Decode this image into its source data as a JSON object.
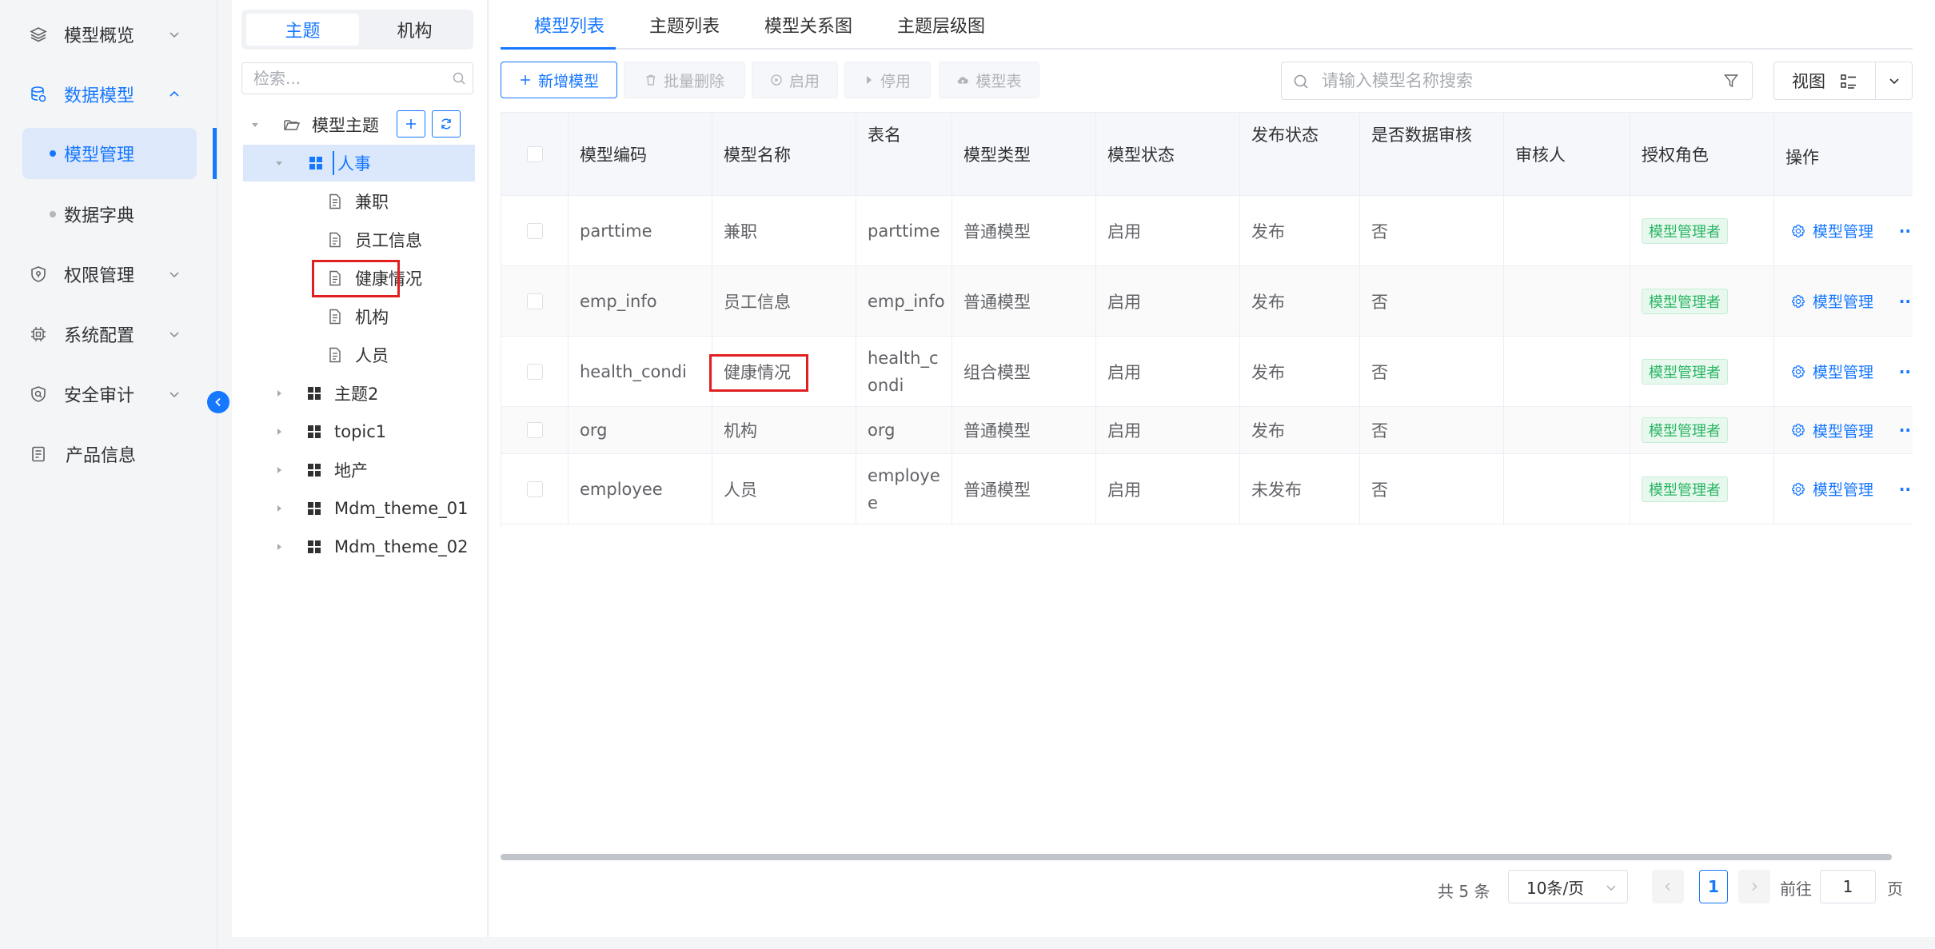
{
  "sidebar": {
    "items": [
      {
        "label": "模型概览",
        "icon": "layers-icon"
      },
      {
        "label": "数据模型",
        "icon": "database-icon"
      },
      {
        "label": "权限管理",
        "icon": "shield-icon"
      },
      {
        "label": "系统配置",
        "icon": "chip-icon"
      },
      {
        "label": "安全审计",
        "icon": "audit-shield-icon"
      },
      {
        "label": "产品信息",
        "icon": "document-icon"
      }
    ],
    "sub_items": [
      {
        "label": "模型管理"
      },
      {
        "label": "数据字典"
      }
    ]
  },
  "tree": {
    "segments": [
      "主题",
      "机构"
    ],
    "search_placeholder": "检索...",
    "root": "模型主题",
    "nodes": [
      {
        "label": "人事"
      },
      {
        "label": "兼职"
      },
      {
        "label": "员工信息"
      },
      {
        "label": "健康情况"
      },
      {
        "label": "机构"
      },
      {
        "label": "人员"
      },
      {
        "label": "主题2"
      },
      {
        "label": "topic1"
      },
      {
        "label": "地产"
      },
      {
        "label": "Mdm_theme_01"
      },
      {
        "label": "Mdm_theme_02"
      }
    ]
  },
  "tabs": [
    "模型列表",
    "主题列表",
    "模型关系图",
    "主题层级图"
  ],
  "toolbar": {
    "add": "新增模型",
    "batch_delete": "批量删除",
    "enable": "启用",
    "disable": "停用",
    "model_table": "模型表",
    "search_placeholder": "请输入模型名称搜索",
    "view": "视图"
  },
  "table": {
    "headers": [
      "模型编码",
      "模型名称",
      "表名",
      "模型类型",
      "模型状态",
      "发布状态",
      "是否数据审核",
      "审核人",
      "授权角色",
      "操作"
    ],
    "rows": [
      {
        "code": "parttime",
        "name": "兼职",
        "table": "parttime",
        "type": "普通模型",
        "status": "启用",
        "publish": "发布",
        "audit": "否",
        "reviewer": "",
        "role": "模型管理者",
        "op": "模型管理"
      },
      {
        "code": "emp_info",
        "name": "员工信息",
        "table": "emp_info",
        "type": "普通模型",
        "status": "启用",
        "publish": "发布",
        "audit": "否",
        "reviewer": "",
        "role": "模型管理者",
        "op": "模型管理"
      },
      {
        "code": "health_condi",
        "name": "健康情况",
        "table": "health_condi",
        "type": "组合模型",
        "status": "启用",
        "publish": "发布",
        "audit": "否",
        "reviewer": "",
        "role": "模型管理者",
        "op": "模型管理"
      },
      {
        "code": "org",
        "name": "机构",
        "table": "org",
        "type": "普通模型",
        "status": "启用",
        "publish": "发布",
        "audit": "否",
        "reviewer": "",
        "role": "模型管理者",
        "op": "模型管理"
      },
      {
        "code": "employee",
        "name": "人员",
        "table": "employee",
        "type": "普通模型",
        "status": "启用",
        "publish": "未发布",
        "audit": "否",
        "reviewer": "",
        "role": "模型管理者",
        "op": "模型管理"
      }
    ]
  },
  "pagination": {
    "total": "共 5 条",
    "page_size": "10条/页",
    "current": "1",
    "goto_prefix": "前往",
    "goto_value": "1",
    "goto_suffix": "页"
  },
  "colors": {
    "accent": "#1677ff",
    "tag_green": "#28b462",
    "highlight_red": "#e02020"
  }
}
